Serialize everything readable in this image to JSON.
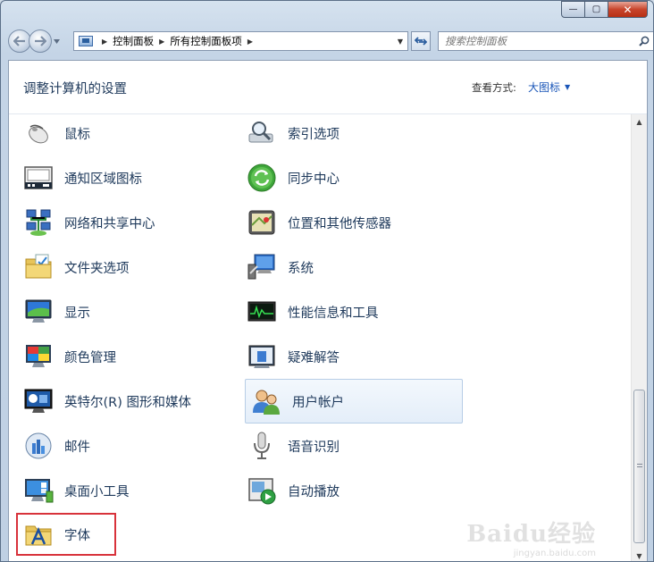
{
  "window": {
    "minimize": "—",
    "maximize": "▢",
    "close": "✕"
  },
  "nav": {
    "back_icon": "arrow-left-icon",
    "forward_icon": "arrow-right-icon"
  },
  "address": {
    "crumbs": [
      "控制面板",
      "所有控制面板项"
    ]
  },
  "search": {
    "placeholder": "搜索控制面板"
  },
  "header": {
    "title": "调整计算机的设置",
    "view_by_label": "查看方式:",
    "view_mode": "大图标"
  },
  "items": [
    {
      "label": "鼠标",
      "icon": "mouse-icon"
    },
    {
      "label": "索引选项",
      "icon": "indexing-icon"
    },
    {
      "label": "通知区域图标",
      "icon": "notification-area-icon"
    },
    {
      "label": "同步中心",
      "icon": "sync-center-icon"
    },
    {
      "label": "网络和共享中心",
      "icon": "network-icon"
    },
    {
      "label": "位置和其他传感器",
      "icon": "location-sensor-icon"
    },
    {
      "label": "文件夹选项",
      "icon": "folder-options-icon"
    },
    {
      "label": "系统",
      "icon": "system-icon"
    },
    {
      "label": "显示",
      "icon": "display-icon"
    },
    {
      "label": "性能信息和工具",
      "icon": "performance-icon"
    },
    {
      "label": "颜色管理",
      "icon": "color-management-icon"
    },
    {
      "label": "疑难解答",
      "icon": "troubleshooting-icon"
    },
    {
      "label": "英特尔(R) 图形和媒体",
      "icon": "intel-graphics-icon"
    },
    {
      "label": "用户帐户",
      "icon": "user-accounts-icon"
    },
    {
      "label": "邮件",
      "icon": "mail-icon"
    },
    {
      "label": "语音识别",
      "icon": "microphone-icon"
    },
    {
      "label": "桌面小工具",
      "icon": "desktop-gadgets-icon"
    },
    {
      "label": "自动播放",
      "icon": "autoplay-icon"
    },
    {
      "label": "字体",
      "icon": "fonts-icon"
    }
  ],
  "watermark": {
    "brand": "Baidu经验",
    "url": "jingyan.baidu.com"
  }
}
